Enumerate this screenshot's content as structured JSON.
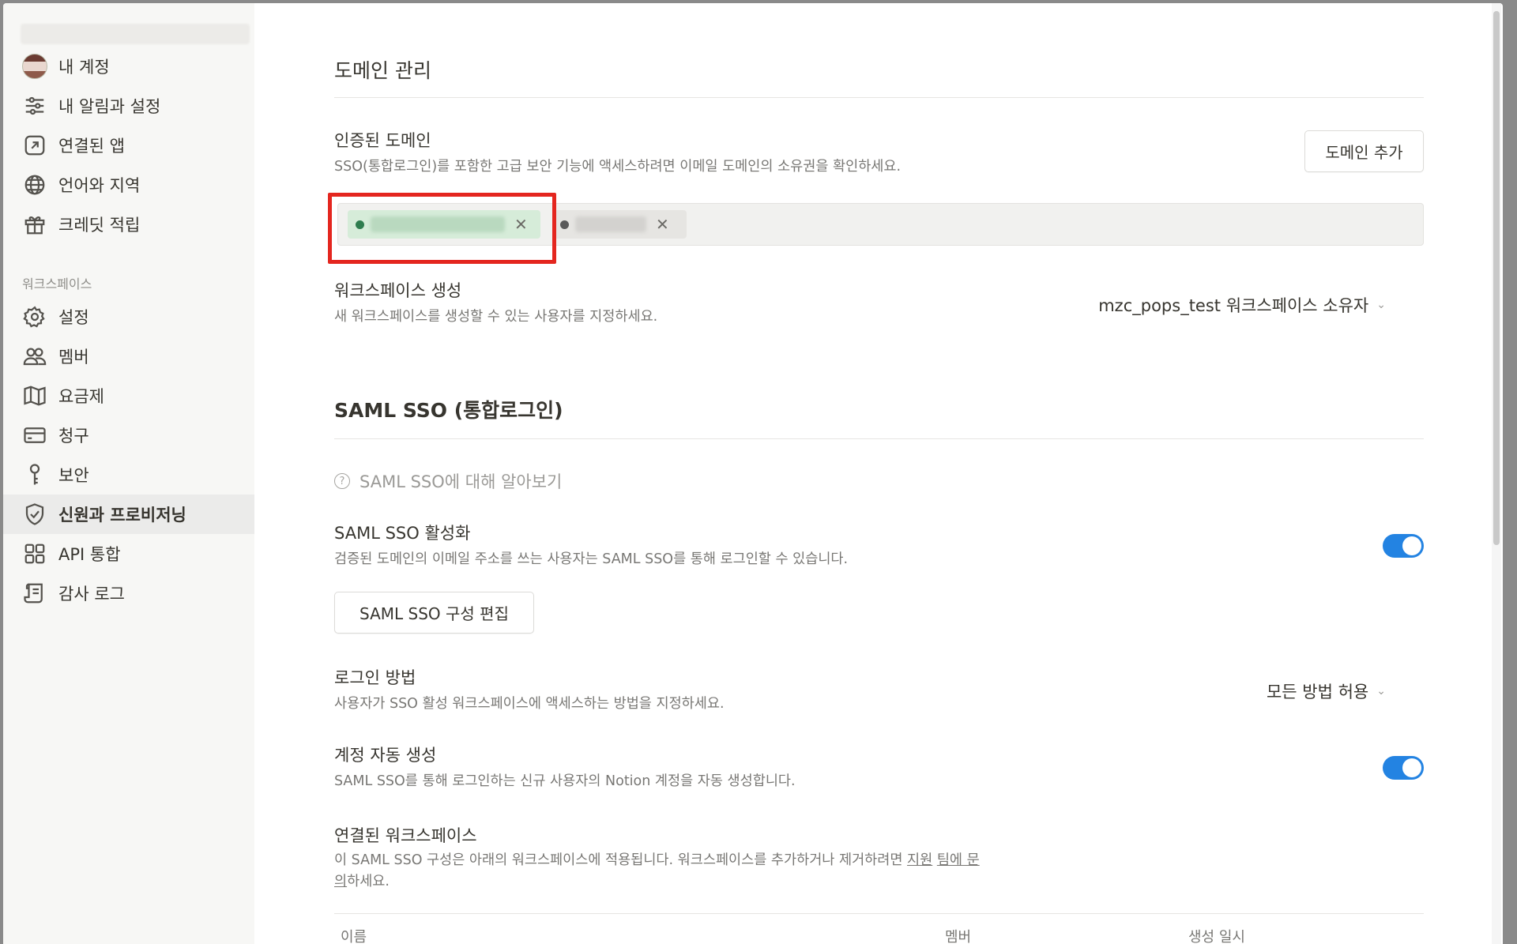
{
  "sidebar": {
    "account_items": [
      {
        "label": "내 계정",
        "icon": "avatar"
      },
      {
        "label": "내 알림과 설정",
        "icon": "sliders-icon"
      },
      {
        "label": "연결된 앱",
        "icon": "external-link-icon"
      },
      {
        "label": "언어와 지역",
        "icon": "globe-icon"
      },
      {
        "label": "크레딧 적립",
        "icon": "gift-icon"
      }
    ],
    "workspace_section": "워크스페이스",
    "workspace_items": [
      {
        "label": "설정",
        "icon": "gear-icon"
      },
      {
        "label": "멤버",
        "icon": "people-icon"
      },
      {
        "label": "요금제",
        "icon": "map-icon"
      },
      {
        "label": "청구",
        "icon": "credit-card-icon"
      },
      {
        "label": "보안",
        "icon": "key-icon"
      },
      {
        "label": "신원과 프로비저닝",
        "icon": "shield-check-icon"
      },
      {
        "label": "API 통합",
        "icon": "grid-icon"
      },
      {
        "label": "감사 로그",
        "icon": "scroll-icon"
      }
    ],
    "active_item": "신원과 프로비저닝"
  },
  "domain_section": {
    "title": "도메인 관리",
    "verified_label": "인증된 도메인",
    "verified_desc": "SSO(통합로그인)를 포함한 고급 보안 기능에 액세스하려면 이메일 도메인의 소유권을 확인하세요.",
    "add_button": "도메인 추가",
    "chips": [
      {
        "status_color": "#2f7d4f",
        "bg": "#d6ecd9",
        "remove": "✕"
      },
      {
        "status_color": "#5a5a5a",
        "bg": "#e6e5e2",
        "remove": "✕"
      }
    ],
    "create_label": "워크스페이스 생성",
    "create_desc": "새 워크스페이스를 생성할 수 있는 사용자를 지정하세요.",
    "create_value": "mzc_pops_test 워크스페이스 소유자"
  },
  "saml_section": {
    "title": "SAML SSO (통합로그인)",
    "help_link": "SAML SSO에 대해 알아보기",
    "enable_label": "SAML SSO 활성화",
    "enable_desc": "검증된 도메인의 이메일 주소를 쓰는 사용자는 SAML SSO를 통해 로그인할 수 있습니다.",
    "enable_on": true,
    "edit_button": "SAML SSO 구성 편집",
    "login_label": "로그인 방법",
    "login_desc": "사용자가 SSO 활성 워크스페이스에 액세스하는 방법을 지정하세요.",
    "login_value": "모든 방법 허용",
    "auto_label": "계정 자동 생성",
    "auto_desc": "SAML SSO를 통해 로그인하는 신규 사용자의 Notion 계정을 자동 생성합니다.",
    "auto_on": true,
    "linked_label": "연결된 워크스페이스",
    "linked_desc_1": "이 SAML SSO 구성은 아래의 워크스페이스에 적용됩니다. 워크스페이스를 추가하거나 제거하려면 ",
    "linked_link_1": "지원",
    "linked_link_2": "팀에 문의",
    "linked_desc_2": "하세요.",
    "table_headers": [
      "이름",
      "멤버",
      "생성 일시"
    ]
  },
  "colors": {
    "accent": "#2383e2",
    "highlight": "#e4261f"
  }
}
